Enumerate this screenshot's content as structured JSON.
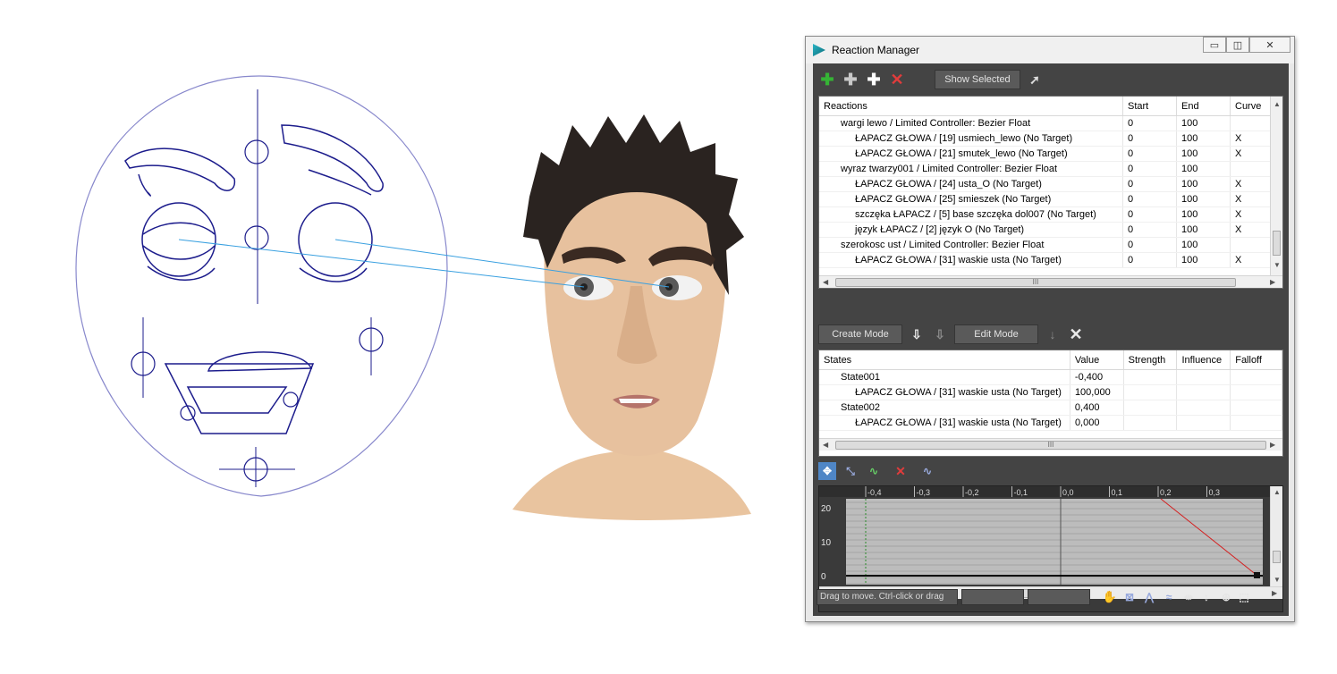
{
  "window": {
    "title": "Reaction Manager",
    "controls": {
      "minimize": "▭",
      "restore": "◫",
      "close": "✕"
    }
  },
  "toolbar": {
    "icons": [
      "add-master-icon",
      "add-selected-icon",
      "add-icon",
      "delete-icon"
    ],
    "show_selected": "Show Selected"
  },
  "reactions": {
    "columns": [
      "Reactions",
      "Start",
      "End",
      "Curve"
    ],
    "rows": [
      {
        "name": "wargi lewo / Limited Controller: Bezier Float",
        "start": "0",
        "end": "100",
        "curve": "",
        "level": 1
      },
      {
        "name": "ŁAPACZ GŁOWA / [19] usmiech_lewo  (No Target)",
        "start": "0",
        "end": "100",
        "curve": "X",
        "level": 2
      },
      {
        "name": "ŁAPACZ GŁOWA / [21] smutek_lewo  (No Target)",
        "start": "0",
        "end": "100",
        "curve": "X",
        "level": 2
      },
      {
        "name": "wyraz twarzy001 / Limited Controller: Bezier Float",
        "start": "0",
        "end": "100",
        "curve": "",
        "level": 1
      },
      {
        "name": "ŁAPACZ GŁOWA / [24] usta_O  (No Target)",
        "start": "0",
        "end": "100",
        "curve": "X",
        "level": 2
      },
      {
        "name": "ŁAPACZ GŁOWA / [25] smieszek  (No Target)",
        "start": "0",
        "end": "100",
        "curve": "X",
        "level": 2
      },
      {
        "name": "szczęka ŁAPACZ / [5] base szczęka dol007  (No Target)",
        "start": "0",
        "end": "100",
        "curve": "X",
        "level": 2
      },
      {
        "name": "język ŁAPACZ / [2] język O  (No Target)",
        "start": "0",
        "end": "100",
        "curve": "X",
        "level": 2
      },
      {
        "name": "szerokosc ust / Limited Controller: Bezier Float",
        "start": "0",
        "end": "100",
        "curve": "",
        "level": 1
      },
      {
        "name": "ŁAPACZ GŁOWA / [31] waskie usta  (No Target)",
        "start": "0",
        "end": "100",
        "curve": "X",
        "level": 2
      }
    ]
  },
  "modes": {
    "create": "Create Mode",
    "edit": "Edit Mode"
  },
  "states": {
    "columns": [
      "States",
      "Value",
      "Strength",
      "Influence",
      "Falloff"
    ],
    "rows": [
      {
        "name": "State001",
        "value": "-0,400",
        "level": 1
      },
      {
        "name": "ŁAPACZ GŁOWA / [31] waskie usta  (No Target)",
        "value": "100,000",
        "level": 2
      },
      {
        "name": "State002",
        "value": "0,400",
        "level": 1
      },
      {
        "name": "ŁAPACZ GŁOWA / [31] waskie usta  (No Target)",
        "value": "0,000",
        "level": 2
      }
    ]
  },
  "curve_editor": {
    "ruler": [
      "-0,4",
      "-0,3",
      "-0,2",
      "-0,1",
      "0,0",
      "0,1",
      "0,2",
      "0,3"
    ],
    "y_labels": [
      "20",
      "10",
      "0"
    ],
    "curve_color": "#d42020"
  },
  "status": {
    "prompt": "Drag to move. Ctrl-click or drag"
  },
  "scrollbar": {
    "grip": "III"
  }
}
